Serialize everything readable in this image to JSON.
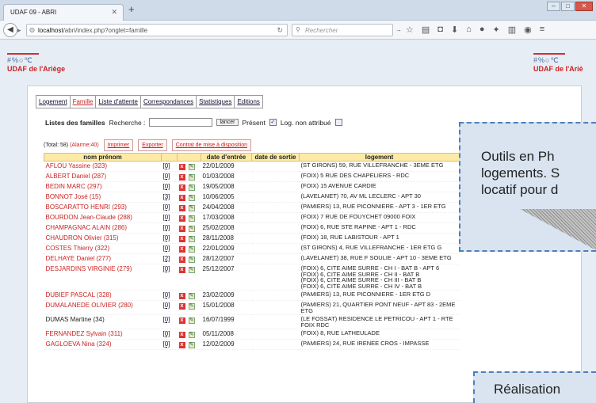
{
  "browser": {
    "tab_title": "UDAF 09 - ABRI",
    "url_host": "localhost",
    "url_path": "/abri/index.php?onglet=famille",
    "search_placeholder": "Rechercher"
  },
  "site": {
    "logo_symbols": "#%○℃",
    "logo_title": "UDAF de l'Ariège",
    "logo_title_cut": "UDAF de l'Ariè"
  },
  "menu": [
    "Logement",
    "Famille",
    "Liste d'attente",
    "Correspondances",
    "Statistiques",
    "Editions"
  ],
  "filters": {
    "heading": "Listes des familles",
    "search_label": "Recherche :",
    "search_value": "",
    "search_button": "lancer",
    "present_label": "Présent",
    "present_checked": true,
    "log_label": "Log. non attribué",
    "log_checked": false
  },
  "totals": {
    "total_text": "(Total: 58)",
    "alarme_text": "(Alarme:40)",
    "print_button": "Imprimer",
    "export_button": "Exporter",
    "contract_button": "Contrat de mise à disposition"
  },
  "table": {
    "headers": [
      "nom prénom",
      "",
      "",
      "date d'entrée",
      "date de sortie",
      "logement"
    ],
    "rows": [
      {
        "name": "AFLOU Yassine (323)",
        "count": "[0]",
        "entry": "22/01/2009",
        "exit": "",
        "logement": "(ST GIRONS) 59, RUE VILLEFRANCHE - 3EME ETG",
        "color": "red"
      },
      {
        "name": "ALBERT Daniel (287)",
        "count": "[0]",
        "entry": "01/03/2008",
        "exit": "",
        "logement": "(FOIX) 5 RUE DES CHAPELIERS - RDC",
        "color": "red"
      },
      {
        "name": "BEDIN MARC (297)",
        "count": "[0]",
        "entry": "19/05/2008",
        "exit": "",
        "logement": "(FOIX) 15 AVENUE CARDIE",
        "color": "red"
      },
      {
        "name": "BONNOT José (15)",
        "count": "[3]",
        "entry": "10/06/2005",
        "exit": "",
        "logement": "(LAVELANET) 70, AV ML LECLERC - APT 30",
        "color": "red"
      },
      {
        "name": "BOSCARATTO HENRI (293)",
        "count": "[0]",
        "entry": "24/04/2008",
        "exit": "",
        "logement": "(PAMIERS) 13, RUE PICONNIERE - APT 3 - 1ER ETG",
        "color": "red"
      },
      {
        "name": "BOURDON Jean-Claude (288)",
        "count": "[0]",
        "entry": "17/03/2008",
        "exit": "",
        "logement": "(FOIX) 7 RUE DE FOUYCHET 09000 FOIX",
        "color": "red"
      },
      {
        "name": "CHAMPAGNAC ALAIN (286)",
        "count": "[0]",
        "entry": "25/02/2008",
        "exit": "",
        "logement": "(FOIX) 6, RUE STE RAPINE - APT 1 - RDC",
        "color": "red"
      },
      {
        "name": "CHAUDRON Olivier (315)",
        "count": "[0]",
        "entry": "28/11/2008",
        "exit": "",
        "logement": "(FOIX) 18, RUE LABISTOUR - APT 1",
        "color": "red"
      },
      {
        "name": "COSTES Thierry (322)",
        "count": "[0]",
        "entry": "22/01/2009",
        "exit": "",
        "logement": "(ST GIRONS) 4, RUE VILLEFRANCHE - 1ER ETG G",
        "color": "red"
      },
      {
        "name": "DELHAYE Daniel (277)",
        "count": "[2]",
        "entry": "28/12/2007",
        "exit": "",
        "logement": "(LAVELANET) 38, RUE F SOULIE - APT 10 - 3EME ETG",
        "color": "red"
      },
      {
        "name": "DESJARDINS VIRGINIE (279)",
        "count": "[0]",
        "entry": "25/12/2007",
        "exit": "",
        "logement": "(FOIX) 6, CITE AIME SURRE - CH I - BAT B - APT 6\n(FOIX) 6, CITE AIME SURRE - CH II - BAT B\n(FOIX) 6, CITE AIME SURRE - CH III - BAT B\n(FOIX) 6, CITE AIME SURRE - CH IV - BAT B",
        "color": "red"
      },
      {
        "name": "DUBIEF PASCAL (328)",
        "count": "[0]",
        "entry": "23/02/2009",
        "exit": "",
        "logement": "(PAMIERS) 13, RUE PICONNIERE - 1ER ETG D",
        "color": "red"
      },
      {
        "name": "DUMALANEDE OLIVIER (280)",
        "count": "[0]",
        "entry": "15/01/2008",
        "exit": "",
        "logement": "(PAMIERS) 21, QUARTIER PONT NEUF - APT 83 - 2EME ETG",
        "color": "red"
      },
      {
        "name": "DUMAS Martine (34)",
        "count": "[0]",
        "entry": "16/07/1999",
        "exit": "",
        "logement": "(LE FOSSAT) RESIDENCE LE PETRICOU - APT 1 - RTE FOIX RDC",
        "color": "black"
      },
      {
        "name": "FERNANDEZ Sylvain (311)",
        "count": "[0]",
        "entry": "05/11/2008",
        "exit": "",
        "logement": "(FOIX) 8, RUE LATHEULADE",
        "color": "red"
      },
      {
        "name": "GAGLOEVA Nina (324)",
        "count": "[0]",
        "entry": "12/02/2009",
        "exit": "",
        "logement": "(PAMIERS) 24, RUE IRENEE CROS - IMPASSE",
        "color": "red"
      }
    ]
  },
  "overlay": {
    "line1": "Outils  en  Ph",
    "line2": "logements.  S",
    "line3": "locatif pour d",
    "bottom": "Réalisation"
  },
  "colors": {
    "accent": "#cc2222",
    "header_bg": "#fdeaa6",
    "overlay_border": "#4e7fbb"
  }
}
